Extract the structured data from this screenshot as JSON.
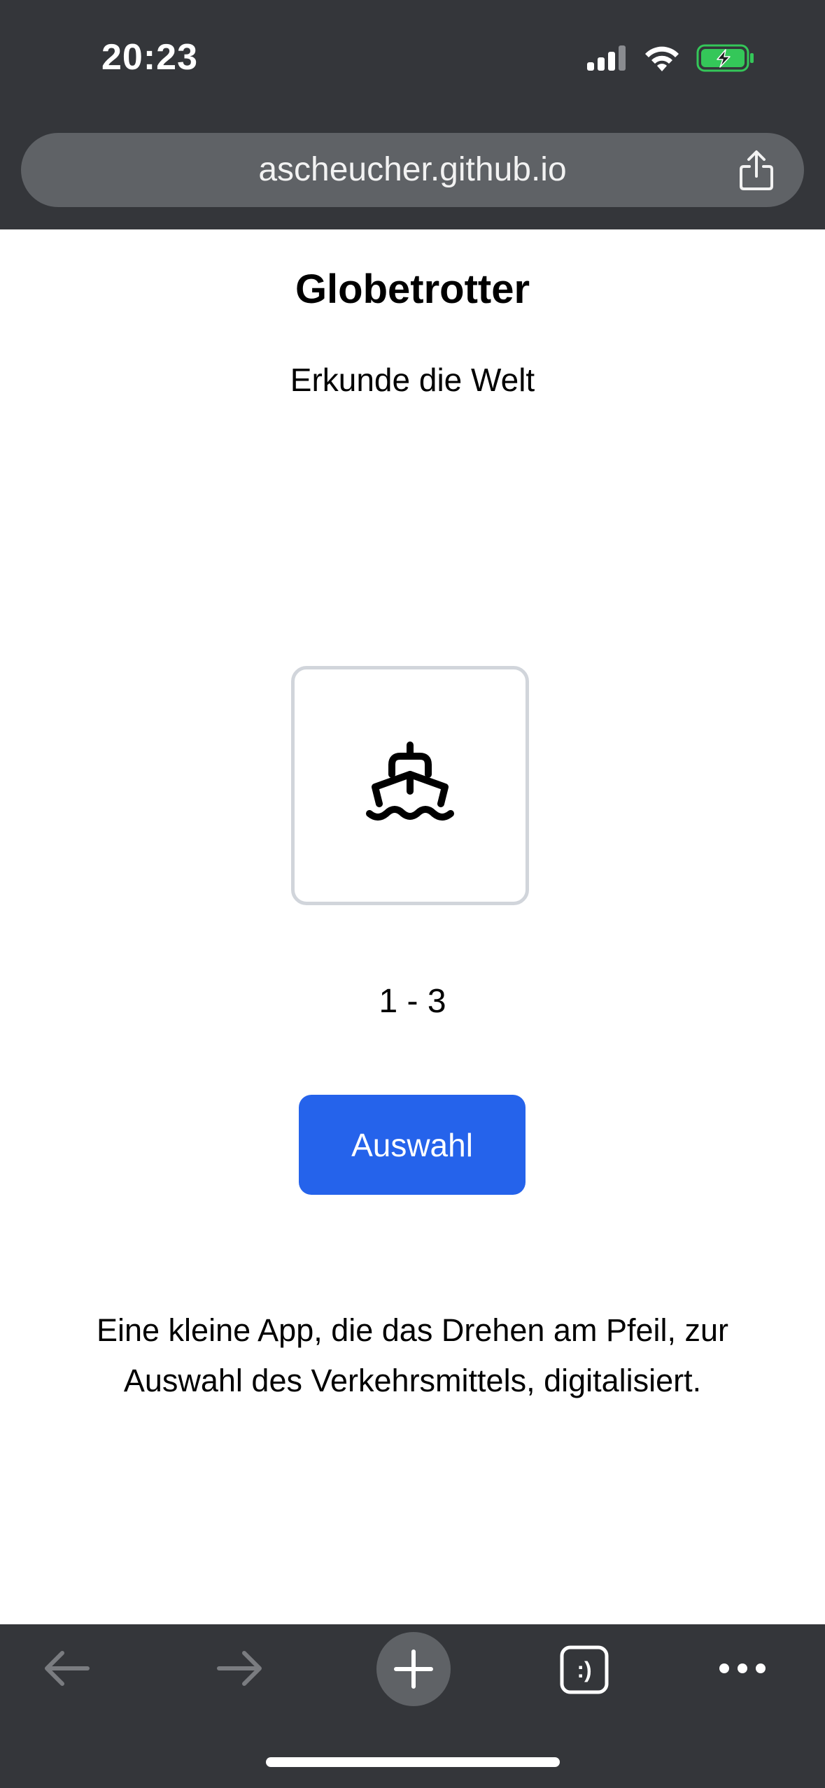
{
  "status_bar": {
    "time": "20:23",
    "icons": [
      "cellular-signal-icon",
      "wifi-icon",
      "battery-charging-icon"
    ],
    "battery_color": "#34c759"
  },
  "browser": {
    "url": "ascheucher.github.io",
    "share_icon": "share-icon",
    "toolbar": {
      "back_icon": "arrow-left-icon",
      "forward_icon": "arrow-right-icon",
      "new_tab_icon": "plus-icon",
      "tabs_icon": "tabs-icon",
      "tabs_badge": ":)",
      "more_icon": "more-dots-icon"
    }
  },
  "page": {
    "title": "Globetrotter",
    "subtitle": "Erkunde die Welt",
    "transport_icon": "ship-icon",
    "range": "1 - 3",
    "select_button": "Auswahl",
    "description": "Eine kleine App, die das Drehen am Pfeil, zur Auswahl des Verkehrsmittels, digitalisiert.",
    "accent_color": "#2563eb"
  }
}
